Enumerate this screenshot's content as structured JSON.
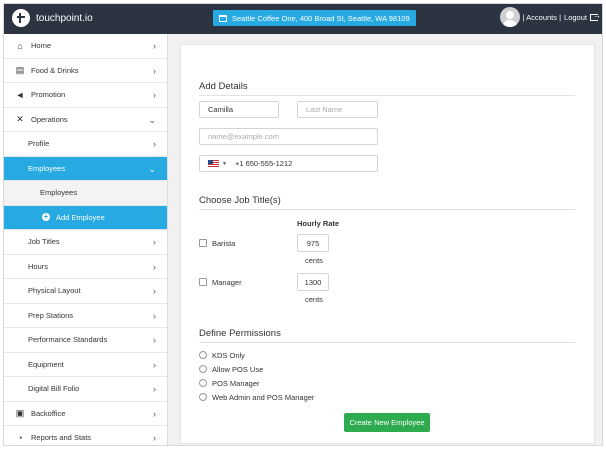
{
  "header": {
    "brand": "touchpoint.io",
    "location": "Seattle Coffee One, 400 Broad St, Seattle, WA 98109",
    "accounts": "| Accounts |",
    "logout": "Logout"
  },
  "sidebar": {
    "items": [
      {
        "label": "Home",
        "icon": "home-icon"
      },
      {
        "label": "Food & Drinks",
        "icon": "book-icon"
      },
      {
        "label": "Promotion",
        "icon": "megaphone-icon"
      },
      {
        "label": "Operations",
        "icon": "tools-icon"
      },
      {
        "label": "Profile"
      },
      {
        "label": "Employees"
      },
      {
        "label": "Employees"
      },
      {
        "label": "Add Employee"
      },
      {
        "label": "Job Titles"
      },
      {
        "label": "Hours"
      },
      {
        "label": "Physical Layout"
      },
      {
        "label": "Prep Stations"
      },
      {
        "label": "Performance Standards"
      },
      {
        "label": "Equipment"
      },
      {
        "label": "Digital Bill Folio"
      },
      {
        "label": "Backoffice",
        "icon": "briefcase-icon"
      },
      {
        "label": "Reports and Stats",
        "icon": "gauge-icon"
      }
    ]
  },
  "form": {
    "details_title": "Add Details",
    "first_name_value": "Camilla",
    "last_name_placeholder": "Last Name",
    "email_placeholder": "name@example.com",
    "phone_value": "+1 650-555-1212",
    "job_title": "Choose Job Title(s)",
    "hourly_rate_label": "Hourly Rate",
    "jobs": [
      {
        "label": "Barista",
        "rate": "975",
        "unit": "cents"
      },
      {
        "label": "Manager",
        "rate": "1300",
        "unit": "cents"
      }
    ],
    "permissions_title": "Define Permissions",
    "permissions": [
      "KDS Only",
      "Allow POS Use",
      "POS Manager",
      "Web Admin and POS Manager"
    ],
    "submit_label": "Create New Employee"
  },
  "colors": {
    "topbar": "#2c3341",
    "accent": "#27a9e1",
    "submit": "#2eaa4f"
  }
}
